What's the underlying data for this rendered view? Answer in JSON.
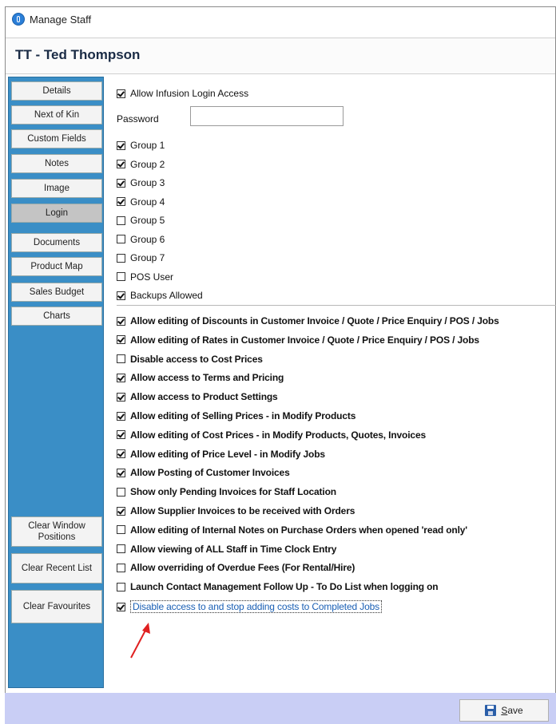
{
  "window": {
    "title": "Manage Staff"
  },
  "header": {
    "title": "TT - Ted Thompson"
  },
  "sidebar": {
    "tabs": [
      {
        "label": "Details"
      },
      {
        "label": "Next of Kin"
      },
      {
        "label": "Custom Fields"
      },
      {
        "label": "Notes"
      },
      {
        "label": "Image"
      },
      {
        "label": "Login",
        "active": true
      },
      {
        "label": "Documents"
      },
      {
        "label": "Product Map"
      },
      {
        "label": "Sales Budget"
      },
      {
        "label": "Charts"
      }
    ],
    "actions": [
      {
        "label": "Clear Window Positions"
      },
      {
        "label": "Clear Recent List"
      },
      {
        "label": "Clear Favourites"
      }
    ]
  },
  "login": {
    "infusion_access": {
      "label": "Allow Infusion Login Access",
      "checked": true
    },
    "password": {
      "label": "Password",
      "value": ""
    },
    "groups": [
      {
        "label": "Group 1",
        "checked": true
      },
      {
        "label": "Group 2",
        "checked": true
      },
      {
        "label": "Group 3",
        "checked": true
      },
      {
        "label": "Group 4",
        "checked": true
      },
      {
        "label": "Group 5",
        "checked": false
      },
      {
        "label": "Group 6",
        "checked": false
      },
      {
        "label": "Group 7",
        "checked": false
      },
      {
        "label": "POS User",
        "checked": false
      },
      {
        "label": "Backups Allowed",
        "checked": true
      }
    ],
    "permissions": [
      {
        "label": "Allow editing of Discounts in Customer Invoice / Quote / Price Enquiry / POS / Jobs",
        "checked": true
      },
      {
        "label": "Allow editing of Rates in Customer Invoice / Quote / Price Enquiry / POS / Jobs",
        "checked": true
      },
      {
        "label": "Disable access to Cost Prices",
        "checked": false
      },
      {
        "label": "Allow access to Terms and Pricing",
        "checked": true
      },
      {
        "label": "Allow access to Product Settings",
        "checked": true
      },
      {
        "label": "Allow editing of Selling Prices - in Modify Products",
        "checked": true
      },
      {
        "label": "Allow editing of Cost Prices - in Modify Products, Quotes, Invoices",
        "checked": true
      },
      {
        "label": "Allow editing of Price Level - in Modify Jobs",
        "checked": true
      },
      {
        "label": "Allow Posting of Customer Invoices",
        "checked": true
      },
      {
        "label": "Show only Pending Invoices for Staff Location",
        "checked": false
      },
      {
        "label": "Allow Supplier Invoices to be received with Orders",
        "checked": true
      },
      {
        "label": "Allow editing of Internal Notes on Purchase Orders when opened 'read only'",
        "checked": false
      },
      {
        "label": "Allow viewing of ALL Staff in Time Clock Entry",
        "checked": false
      },
      {
        "label": "Allow overriding of Overdue Fees (For Rental/Hire)",
        "checked": false
      },
      {
        "label": "Launch Contact Management Follow Up - To Do List when logging on",
        "checked": false
      },
      {
        "label": "Disable access to and stop adding costs to Completed Jobs",
        "checked": true,
        "focused": true
      }
    ]
  },
  "footer": {
    "save_label": "Save",
    "save_accel": "S",
    "save_rest": "ave"
  },
  "colors": {
    "sidebar": "#3a8ec6",
    "footer": "#c9cef5",
    "focus_text": "#1a5fb4",
    "annotation_arrow": "#e02020"
  },
  "icons": {
    "window": "app-info-icon",
    "save": "floppy-disk-icon",
    "annotation": "red-arrow-icon"
  }
}
